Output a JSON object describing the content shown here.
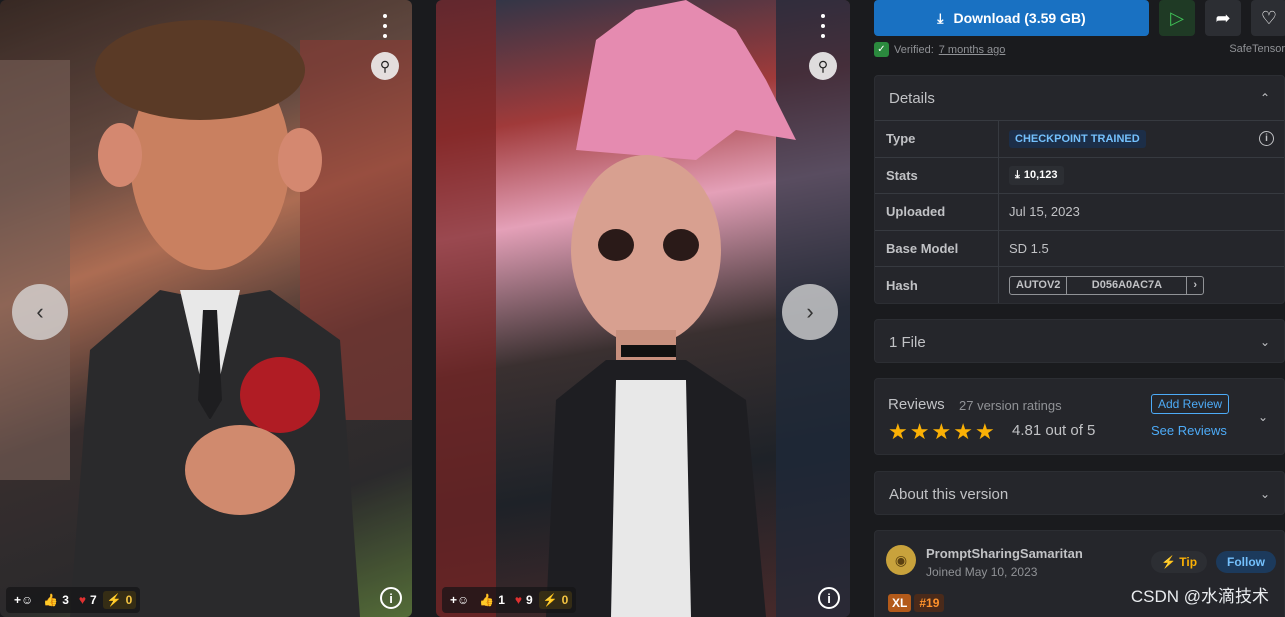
{
  "images": [
    {
      "reactions": {
        "like": "3",
        "heart": "7",
        "bolt": "0"
      },
      "icons": [
        "add-reaction-icon",
        "thumbs-up-icon",
        "heart-icon",
        "bolt-icon",
        "info-icon",
        "remix-icon",
        "more-icon",
        "chevron-left-icon"
      ]
    },
    {
      "reactions": {
        "like": "1",
        "heart": "9",
        "bolt": "0"
      },
      "icons": [
        "add-reaction-icon",
        "thumbs-up-icon",
        "heart-icon",
        "bolt-icon",
        "info-icon",
        "remix-icon",
        "more-icon",
        "chevron-right-icon"
      ]
    }
  ],
  "actions": {
    "download_label": "Download (3.59 GB)"
  },
  "verified": {
    "label": "Verified:",
    "when": "7 months ago",
    "format": "SafeTensor"
  },
  "details": {
    "title": "Details",
    "rows": {
      "type_label": "Type",
      "type_value": "CHECKPOINT TRAINED",
      "stats_label": "Stats",
      "stats_value": "10,123",
      "uploaded_label": "Uploaded",
      "uploaded_value": "Jul 15, 2023",
      "base_label": "Base Model",
      "base_value": "SD 1.5",
      "hash_label": "Hash",
      "hash_type": "AUTOV2",
      "hash_value": "D056A0AC7A"
    }
  },
  "files": {
    "title": "1 File"
  },
  "reviews": {
    "title": "Reviews",
    "count": "27 version ratings",
    "rating": 4.81,
    "score": "4.81 out of 5",
    "add_label": "Add Review",
    "see_label": "See Reviews"
  },
  "about": {
    "title": "About this version"
  },
  "creator": {
    "name": "PromptSharingSamaritan",
    "joined": "Joined May 10, 2023",
    "tip_label": "Tip",
    "follow_label": "Follow",
    "badge": "XL",
    "rank": "#19"
  },
  "watermark": "CSDN @水滴技术",
  "colors": {
    "accent": "#1971c2",
    "star": "#fab005",
    "panel_bg": "#25262b",
    "page_bg": "#1a1b1e"
  }
}
